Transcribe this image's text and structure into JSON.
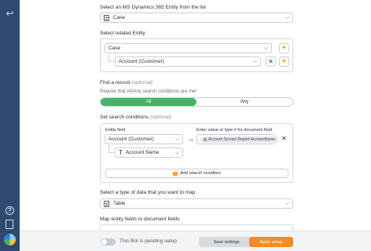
{
  "entity_section": {
    "label": "Select an MS Dynamics 365 Entity from the list",
    "selected": "Case"
  },
  "related_section": {
    "label": "Select related Entity",
    "parent_value": "Case",
    "child_value": "Account (Customer)"
  },
  "find_section": {
    "label": "Find a record",
    "optional": "(optional)",
    "hint": "Require that All/Any search conditions are met",
    "options": [
      "All",
      "Any"
    ],
    "selected": "All"
  },
  "search_section": {
    "label": "Set search conditions",
    "optional": "(optional)",
    "entity_field_label": "Entity field",
    "value_label": "Enter value or type # for document field",
    "entity_field_value": "Account (Customer)",
    "sub_field_value": "Account Name",
    "token_value": "Account Service Report AccountName",
    "add_label": "Add search condition"
  },
  "data_type_section": {
    "label": "Select a type of data that you want to map",
    "selected": "Table"
  },
  "map_section": {
    "label": "Map entity fields to document fields"
  },
  "footer": {
    "status_text": "This Bot is pending setup",
    "save_label": "Save settings",
    "apply_label": "Apply setup"
  },
  "colors": {
    "rail": "#2f4a6e",
    "accent_green": "#43b567",
    "accent_orange": "#f68c1f"
  },
  "icons": {
    "back": "back-arrow-icon",
    "help": "help-icon",
    "docs": "document-icon",
    "logo": "app-logo-icon"
  }
}
